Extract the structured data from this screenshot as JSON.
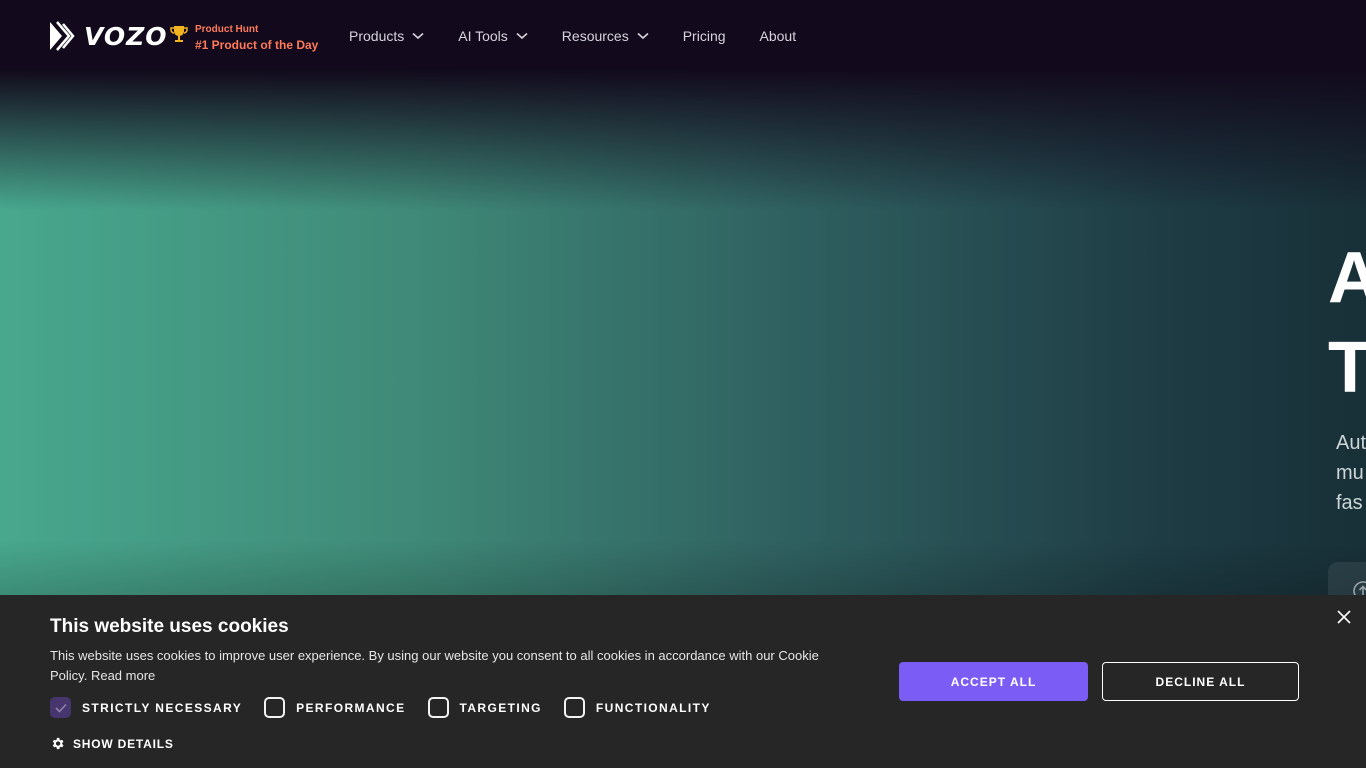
{
  "brand": {
    "name": "VOZO"
  },
  "product_hunt": {
    "label": "Product Hunt",
    "badge": "#1 Product of the Day"
  },
  "nav": {
    "items": [
      {
        "label": "Products",
        "dropdown": true
      },
      {
        "label": "AI Tools",
        "dropdown": true
      },
      {
        "label": "Resources",
        "dropdown": true
      },
      {
        "label": "Pricing",
        "dropdown": false
      },
      {
        "label": "About",
        "dropdown": false
      }
    ]
  },
  "hero": {
    "title_line1": "A",
    "title_line2": "T",
    "subtitle_lines": [
      "Aut",
      "mu",
      "fas"
    ]
  },
  "cookie": {
    "title": "This website uses cookies",
    "text": "This website uses cookies to improve user experience. By using our website you consent to all cookies in accordance with our Cookie Policy.",
    "read_more": "Read more",
    "categories": [
      {
        "label": "STRICTLY NECESSARY",
        "checked": true
      },
      {
        "label": "PERFORMANCE",
        "checked": false
      },
      {
        "label": "TARGETING",
        "checked": false
      },
      {
        "label": "FUNCTIONALITY",
        "checked": false
      }
    ],
    "show_details": "SHOW DETAILS",
    "accept_label": "ACCEPT ALL",
    "decline_label": "DECLINE ALL"
  },
  "colors": {
    "accent": "#7b5cf5",
    "product_hunt": "#ff7a5a",
    "cookie_bg": "#262626",
    "checkbox_checked": "#47366e"
  },
  "icons": {
    "logo": "vozo-chevrons-icon",
    "trophy": "trophy-icon",
    "dropdown": "chevron-down-icon",
    "gear": "gear-icon",
    "close": "close-icon"
  }
}
